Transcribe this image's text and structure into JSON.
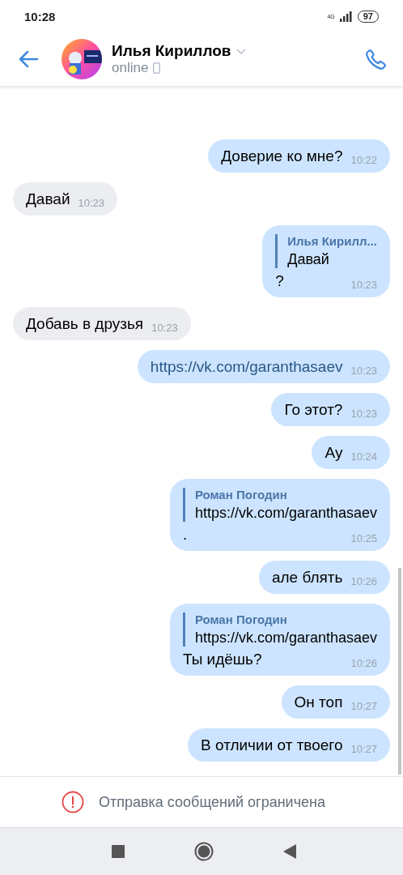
{
  "status_bar": {
    "time": "10:28",
    "network": "4G",
    "battery": "97"
  },
  "header": {
    "title": "Илья Кириллов",
    "status": "online"
  },
  "messages": [
    {
      "outgoing": true,
      "kind": "text",
      "text": "Доверие ко мне?",
      "time": "10:22"
    },
    {
      "outgoing": false,
      "kind": "text",
      "text": "Давай",
      "time": "10:23"
    },
    {
      "outgoing": true,
      "kind": "reply",
      "reply": {
        "author": "Илья Кирилл...",
        "text": "Давай"
      },
      "text": "?",
      "time": "10:23"
    },
    {
      "outgoing": false,
      "kind": "text",
      "text": "Добавь в друзья",
      "time": "10:23"
    },
    {
      "outgoing": true,
      "kind": "link",
      "text": "https://vk.com/garanthasaev",
      "time": "10:23"
    },
    {
      "outgoing": true,
      "kind": "text",
      "text": "Го этот?",
      "time": "10:23"
    },
    {
      "outgoing": true,
      "kind": "text",
      "text": "Ау",
      "time": "10:24"
    },
    {
      "outgoing": true,
      "kind": "reply",
      "reply": {
        "author": "Роман Погодин",
        "text": "https://vk.com/garanthasaev"
      },
      "text": ".",
      "time": "10:25"
    },
    {
      "outgoing": true,
      "kind": "text",
      "text": "але блять",
      "time": "10:26"
    },
    {
      "outgoing": true,
      "kind": "reply",
      "reply": {
        "author": "Роман Погодин",
        "text": "https://vk.com/garanthasaev"
      },
      "text": "Ты идёшь?",
      "time": "10:26"
    },
    {
      "outgoing": true,
      "kind": "text",
      "text": "Он топ",
      "time": "10:27"
    },
    {
      "outgoing": true,
      "kind": "text",
      "text": "В отличии от твоего",
      "time": "10:27"
    }
  ],
  "notice": {
    "text": "Отправка сообщений ограничена"
  }
}
